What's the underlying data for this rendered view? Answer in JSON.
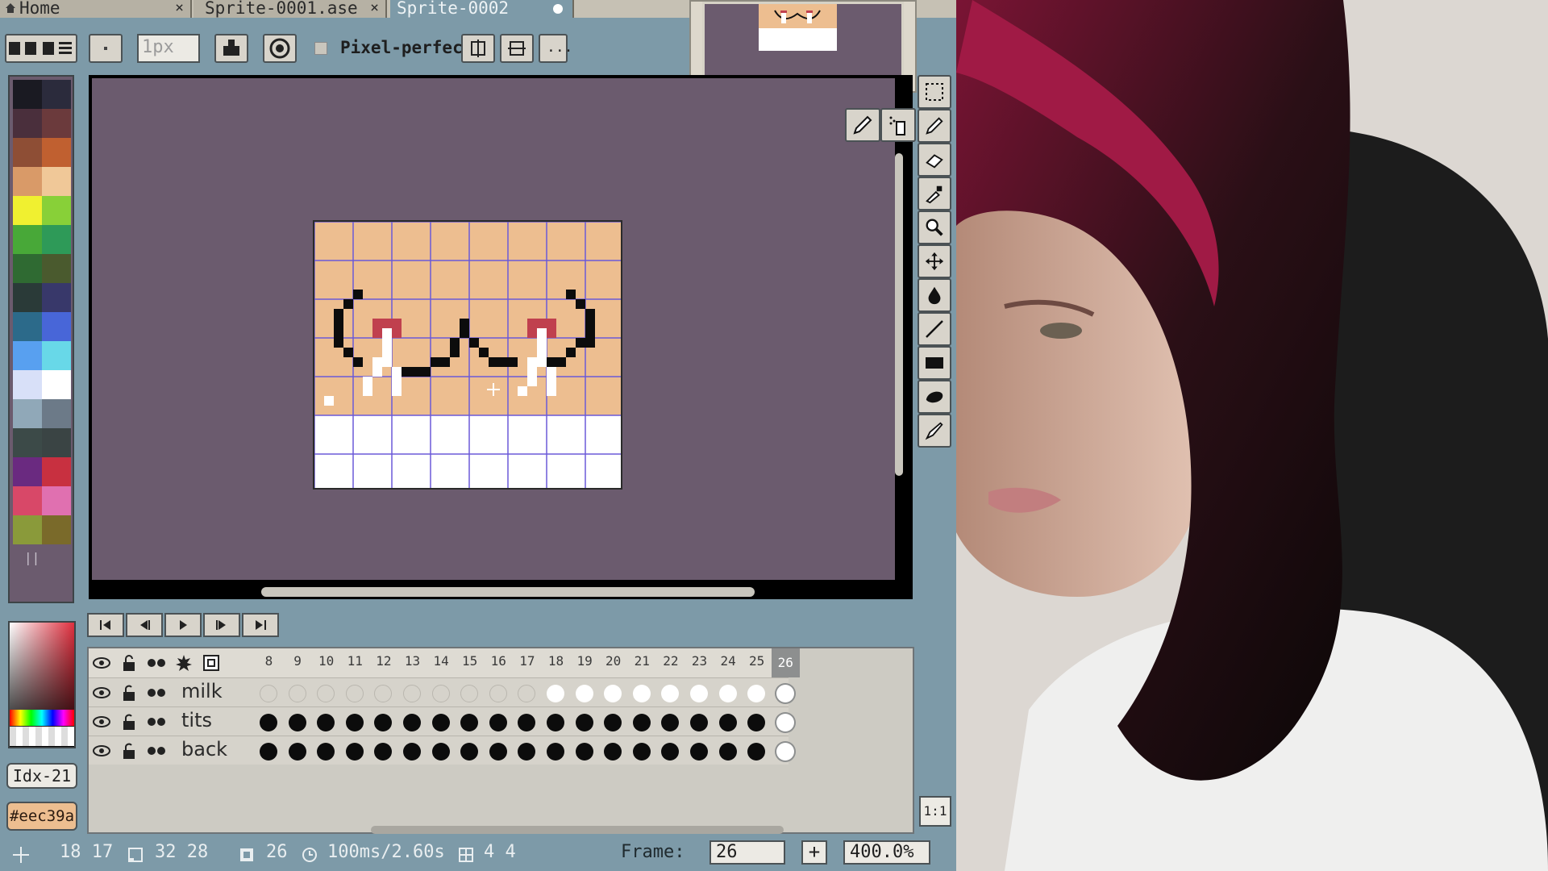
{
  "tabs": [
    {
      "label": "Home",
      "close": "×"
    },
    {
      "label": "Sprite-0001.ase",
      "close": "×"
    },
    {
      "label": "Sprite-0002",
      "modified": true
    }
  ],
  "toolbar": {
    "brush_size": "1px",
    "pixel_perfect_label": "Pixel-perfect",
    "pixel_perfect_checked": false,
    "more": "..."
  },
  "palette": {
    "colors": [
      "#1a1a22",
      "#2b2b3c",
      "#4a2f3c",
      "#6b3a3c",
      "#8e4e35",
      "#c06030",
      "#d99a68",
      "#f0c898",
      "#f0f030",
      "#88d038",
      "#48a838",
      "#2e9a58",
      "#2f6a32",
      "#4a5a2e",
      "#2a3a38",
      "#38386a",
      "#2c6a8a",
      "#4866d8",
      "#58a0f0",
      "#68d8e8",
      "#d8e0f8",
      "#ffffff",
      "#90a8b8",
      "#6c7a88",
      "#3c4a48",
      "#3a4444",
      "#6a2a80",
      "#c83040",
      "#d84868",
      "#e070b0",
      "#8a9a3a",
      "#7a6a2a"
    ],
    "handle": "||",
    "index_label": "Idx-21",
    "hex_label": "#eec39a",
    "selected_color": "#edbe90"
  },
  "timeline": {
    "frames": [
      "8",
      "9",
      "10",
      "11",
      "12",
      "13",
      "14",
      "15",
      "16",
      "17",
      "18",
      "19",
      "20",
      "21",
      "22",
      "23",
      "24",
      "25",
      "26"
    ],
    "active_frame": "26",
    "layers": [
      {
        "name": "milk",
        "cels": "eeeeeeeeeewwwwwwwwW"
      },
      {
        "name": "tits",
        "cels": "ddddddddddddddddddW"
      },
      {
        "name": "back",
        "cels": "ddddddddddddddddddW"
      }
    ],
    "actual_size_btn": "1:1"
  },
  "status": {
    "cursor_pos": "18  17",
    "sprite_size": "32  28",
    "frame_count": "26",
    "duration": "100ms/2.60s",
    "grid": "4  4",
    "frame_label": "Frame:",
    "frame_value": "26",
    "plus": "+",
    "zoom": "400.0%"
  },
  "colors": {
    "ui_bg": "#7d9aa8",
    "canvas_bg": "#6b5b6e",
    "skin": "#edbe90",
    "nipple": "#c0404e",
    "grid_line": "#6b5ad8"
  }
}
